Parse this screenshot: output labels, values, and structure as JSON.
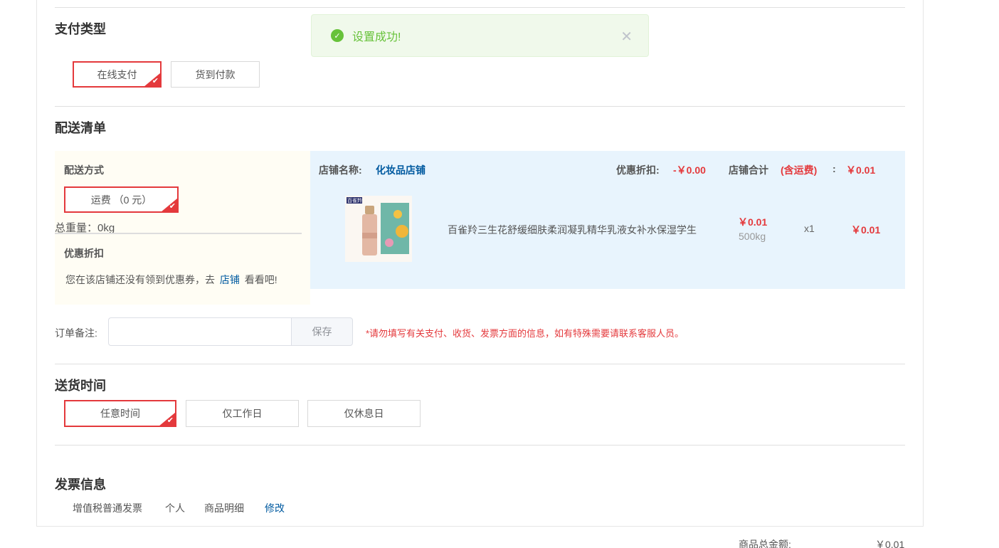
{
  "toast": {
    "message": "设置成功!",
    "icon": "check-circle-icon",
    "close_icon": "close-icon"
  },
  "payment": {
    "title": "支付类型",
    "options": [
      {
        "label": "在线支付",
        "selected": true
      },
      {
        "label": "货到付款",
        "selected": false
      }
    ]
  },
  "shipping": {
    "title": "配送清单",
    "method_title": "配送方式",
    "method_option": "运费 （0 元）",
    "total_weight": "总重量：0kg",
    "discount_title": "优惠折扣",
    "coupon_text_before": "您在该店铺还没有领到优惠券，去",
    "coupon_link": "店铺",
    "coupon_text_after": "看看吧!"
  },
  "store": {
    "name_label": "店铺名称:",
    "name": "化妆品店铺",
    "discount_label": "优惠折扣:",
    "discount_value": "-￥0.00",
    "total_label": "店铺合计",
    "total_note": "(含运费)",
    "total_colon": ":",
    "total_value": "￥0.01",
    "product": {
      "image_brand": "百雀羚",
      "name": "百雀羚三生花舒缓细肤柔润凝乳精华乳液女补水保湿学生",
      "price": "￥0.01",
      "weight": "500kg",
      "quantity": "x1",
      "subtotal": "￥0.01"
    }
  },
  "remark": {
    "label": "订单备注:",
    "value": "",
    "save_label": "保存",
    "hint": "*请勿填写有关支付、收货、发票方面的信息，如有特殊需要请联系客服人员。"
  },
  "delivery_time": {
    "title": "送货时间",
    "options": [
      {
        "label": "任意时间",
        "selected": true
      },
      {
        "label": "仅工作日",
        "selected": false
      },
      {
        "label": "仅休息日",
        "selected": false
      }
    ]
  },
  "invoice": {
    "title": "发票信息",
    "type": "增值税普通发票",
    "holder": "个人",
    "content": "商品明细",
    "edit_label": "修改"
  },
  "summary": {
    "label": "商品总金额:",
    "value": "￥0.01"
  },
  "colors": {
    "accent": "#e4393c",
    "link": "#005aa0",
    "success": "#67c23a"
  }
}
